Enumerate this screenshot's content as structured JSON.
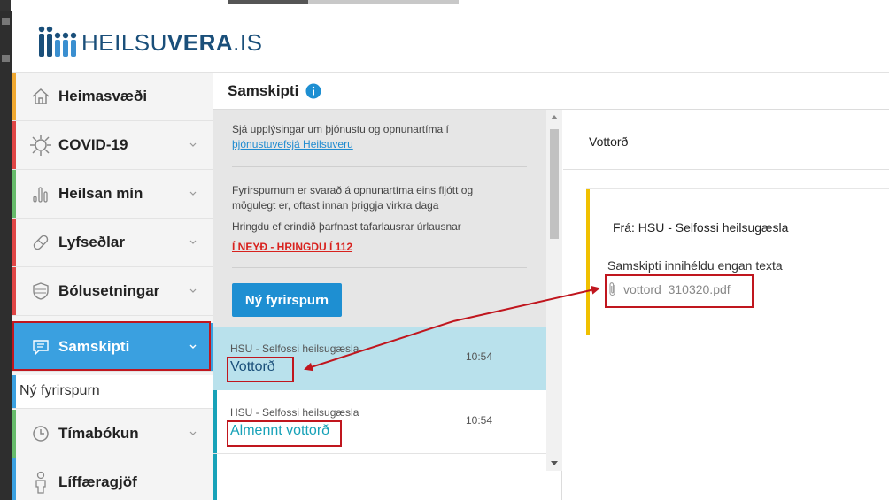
{
  "brand": {
    "logo_text_light": "HEILSU",
    "logo_text_bold": "VERA",
    "logo_text_suffix": ".IS"
  },
  "sidebar": {
    "items": [
      {
        "label": "Heimasvæði",
        "icon": "home-icon",
        "accent": "#f0a830",
        "chevron": false
      },
      {
        "label": "COVID-19",
        "icon": "virus-icon",
        "accent": "#e04545",
        "chevron": true
      },
      {
        "label": "Heilsan mín",
        "icon": "bar-chart-icon",
        "accent": "#66bb6a",
        "chevron": true
      },
      {
        "label": "Lyfseðlar",
        "icon": "pill-icon",
        "accent": "#e04545",
        "chevron": true
      },
      {
        "label": "Bólusetningar",
        "icon": "shield-icon",
        "accent": "#e04545",
        "chevron": true
      },
      {
        "label": "Samskipti",
        "icon": "message-icon",
        "accent": "#3aa0e0",
        "chevron": true,
        "active": true
      },
      {
        "label": "Tímabókun",
        "icon": "clock-icon",
        "accent": "#66bb6a",
        "chevron": true
      },
      {
        "label": "Líffæragjöf",
        "icon": "person-icon",
        "accent": "#3aa0e0",
        "chevron": false
      }
    ],
    "sub_item": "Ný fyrirspurn"
  },
  "section": {
    "title": "Samskipti",
    "info_icon": "info-icon"
  },
  "infobox": {
    "line1": "Sjá upplýsingar um þjónustu og opnunartíma í",
    "link": "þjónustuvefsjá Heilsuveru",
    "line2": "Fyrirspurnum er svarað á opnunartíma eins fljótt og",
    "line3": "mögulegt er, oftast innan þriggja virkra daga",
    "line4": "Hringdu ef erindið þarfnast tafarlausrar úrlausnar",
    "emergency": "Í NEYÐ - HRINGDU Í 112",
    "new_button": "Ný fyrirspurn"
  },
  "messages": [
    {
      "from": "HSU - Selfossi heilsugæsla",
      "subject": "Vottorð",
      "time": "10:54",
      "selected": true
    },
    {
      "from": "HSU - Selfossi heilsugæsla",
      "subject": "Almennt vottorð",
      "time": "10:54",
      "selected": false
    }
  ],
  "detail": {
    "title": "Vottorð",
    "from": "Frá: HSU - Selfossi heilsugæsla",
    "body": "Samskipti innihéldu engan texta",
    "attachment": "vottord_310320.pdf"
  },
  "colors": {
    "brand_blue": "#1a4f7a",
    "active_blue": "#3aa0e0",
    "button_blue": "#1e8fd2",
    "selected_row": "#b9e1ec",
    "annotation_red": "#c0161e",
    "detail_bar": "#f0c000"
  }
}
